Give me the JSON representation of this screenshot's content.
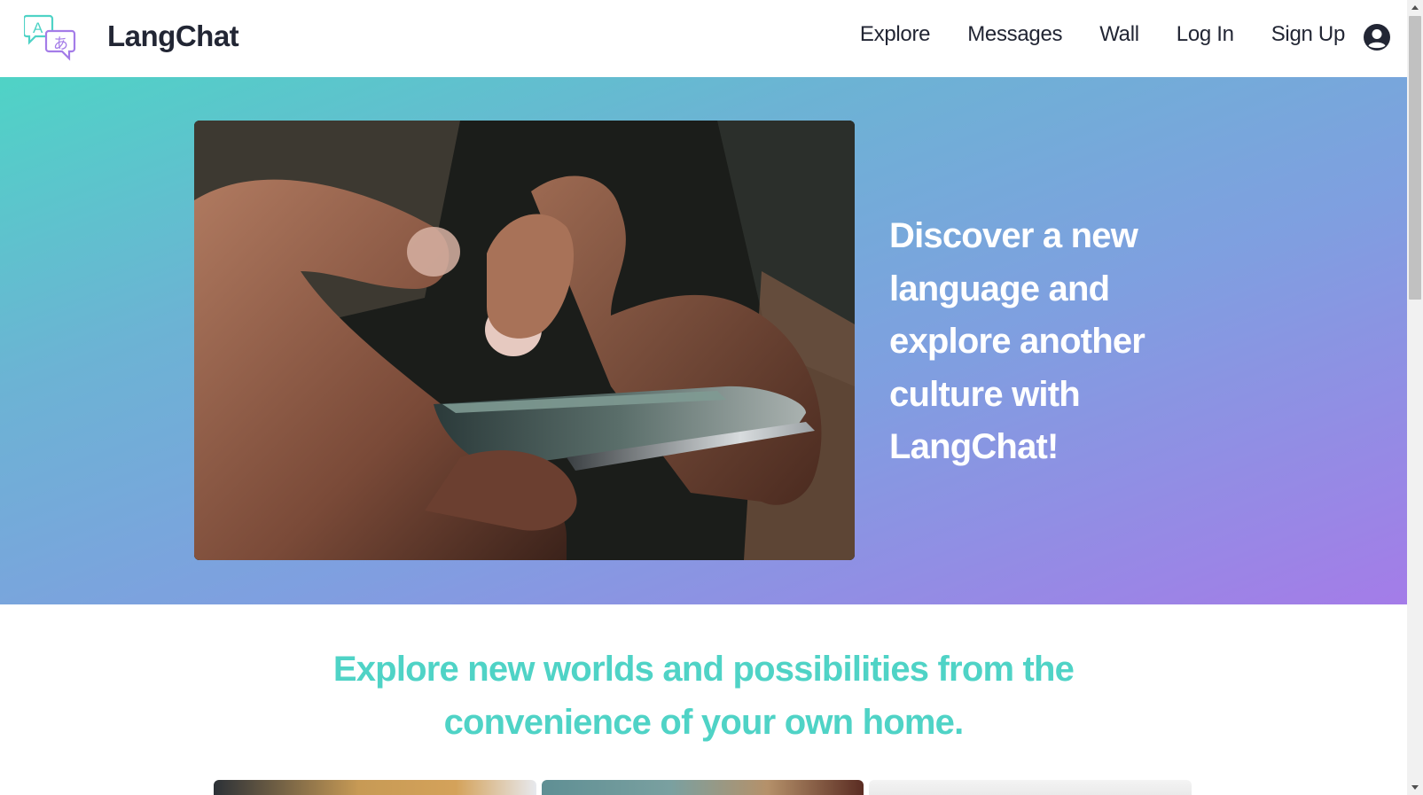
{
  "app": {
    "brand": "LangChat",
    "logo_glyphs": {
      "latin": "A",
      "kana": "あ"
    },
    "accent_color": "#4fd3c6",
    "secondary_color": "#a47ce8"
  },
  "nav": {
    "links": [
      {
        "label": "Explore"
      },
      {
        "label": "Messages"
      },
      {
        "label": "Wall"
      },
      {
        "label": "Log In"
      },
      {
        "label": "Sign Up"
      }
    ],
    "account_icon": "user-circle-icon"
  },
  "hero": {
    "heading": "Discover a new language and explore another culture with LangChat!",
    "image_subject": "hands holding a smartphone and typing"
  },
  "explore": {
    "heading": "Explore new worlds and possibilities from the convenience of your own home.",
    "cards_visible": 3
  }
}
